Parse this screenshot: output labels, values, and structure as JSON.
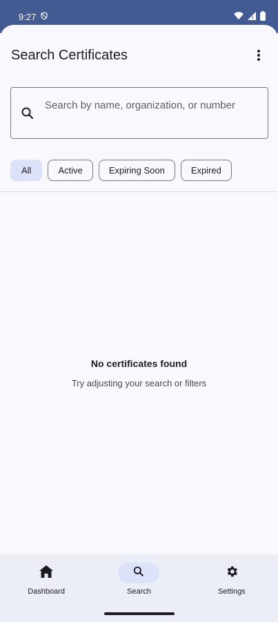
{
  "status_bar": {
    "time": "9:27",
    "icons": [
      "shield-off-icon",
      "wifi-icon",
      "signal-icon",
      "battery-icon"
    ]
  },
  "app_bar": {
    "title": "Search Certificates",
    "menu_icon": "more-vert-icon"
  },
  "search": {
    "placeholder": "Search by name, organization, or number",
    "value": "",
    "icon": "search-icon"
  },
  "filters": {
    "chips": [
      {
        "label": "All",
        "selected": true
      },
      {
        "label": "Active",
        "selected": false
      },
      {
        "label": "Expiring Soon",
        "selected": false
      },
      {
        "label": "Expired",
        "selected": false
      }
    ]
  },
  "empty_state": {
    "title": "No certificates found",
    "subtitle": "Try adjusting your search or filters"
  },
  "bottom_nav": {
    "items": [
      {
        "label": "Dashboard",
        "icon": "home-icon",
        "active": false
      },
      {
        "label": "Search",
        "icon": "search-icon",
        "active": true
      },
      {
        "label": "Settings",
        "icon": "gear-icon",
        "active": false
      }
    ]
  },
  "colors": {
    "status_bar": "#445a93",
    "background": "#f8f8fd",
    "selected_chip": "#dce2f9",
    "nav_background": "#eceef7"
  }
}
